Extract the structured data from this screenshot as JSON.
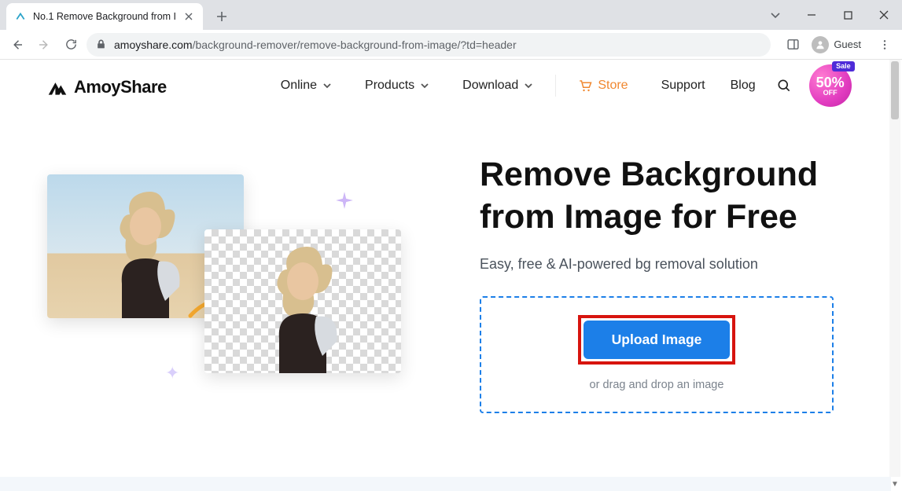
{
  "browser": {
    "tab_title": "No.1 Remove Background from I",
    "guest_label": "Guest",
    "url_host": "amoyshare.com",
    "url_path": "/background-remover/remove-background-from-image/?td=header"
  },
  "header": {
    "brand": "AmoyShare",
    "nav": {
      "online": "Online",
      "products": "Products",
      "download": "Download"
    },
    "store": "Store",
    "support": "Support",
    "blog": "Blog",
    "sale": {
      "tag": "Sale",
      "percent": "50%",
      "off": "OFF"
    }
  },
  "hero": {
    "title_line1": "Remove Background",
    "title_line2": "from Image for Free",
    "subtitle": "Easy, free & AI-powered bg removal solution",
    "upload_label": "Upload Image",
    "drop_hint": "or drag and drop an image"
  }
}
